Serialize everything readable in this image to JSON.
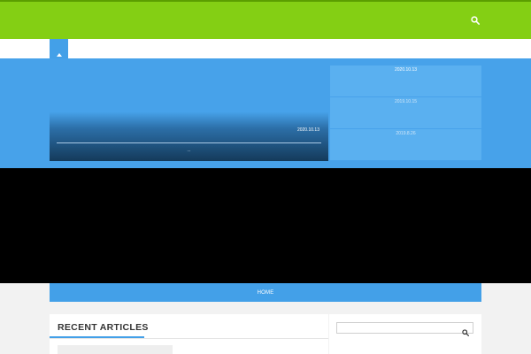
{
  "header": {
    "search_icon": "search-icon",
    "accent_color": "#84cf14",
    "scroll_up_icon": "chevron-up-icon"
  },
  "hero": {
    "background_color": "#47a2ea",
    "featured": {
      "date": "2020.10.13",
      "more_label": "..."
    },
    "side_posts": [
      {
        "date": "2020.10.13"
      },
      {
        "date": "2019.10.15"
      },
      {
        "date": "2019.8.26"
      }
    ]
  },
  "nav": {
    "home_label": "HOME",
    "color": "#43a0e8"
  },
  "main": {
    "recent_articles_title": "RECENT ARTICLES"
  },
  "sidebar": {
    "search_placeholder": "",
    "search_icon": "search-icon"
  }
}
